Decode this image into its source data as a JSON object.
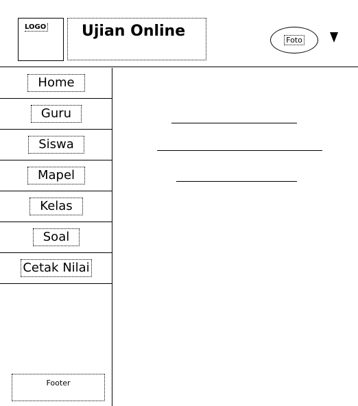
{
  "header": {
    "logo_label": "LOGO",
    "title": "Ujian Online",
    "avatar_label": "Foto"
  },
  "sidebar": {
    "items": [
      {
        "label": "Home"
      },
      {
        "label": "Guru"
      },
      {
        "label": "Siswa"
      },
      {
        "label": "Mapel"
      },
      {
        "label": "Kelas"
      },
      {
        "label": "Soal"
      },
      {
        "label": "Cetak Nilai"
      }
    ],
    "footer_label": "Footer"
  },
  "icons": {
    "menu_arrow": "triangle-down-icon"
  }
}
